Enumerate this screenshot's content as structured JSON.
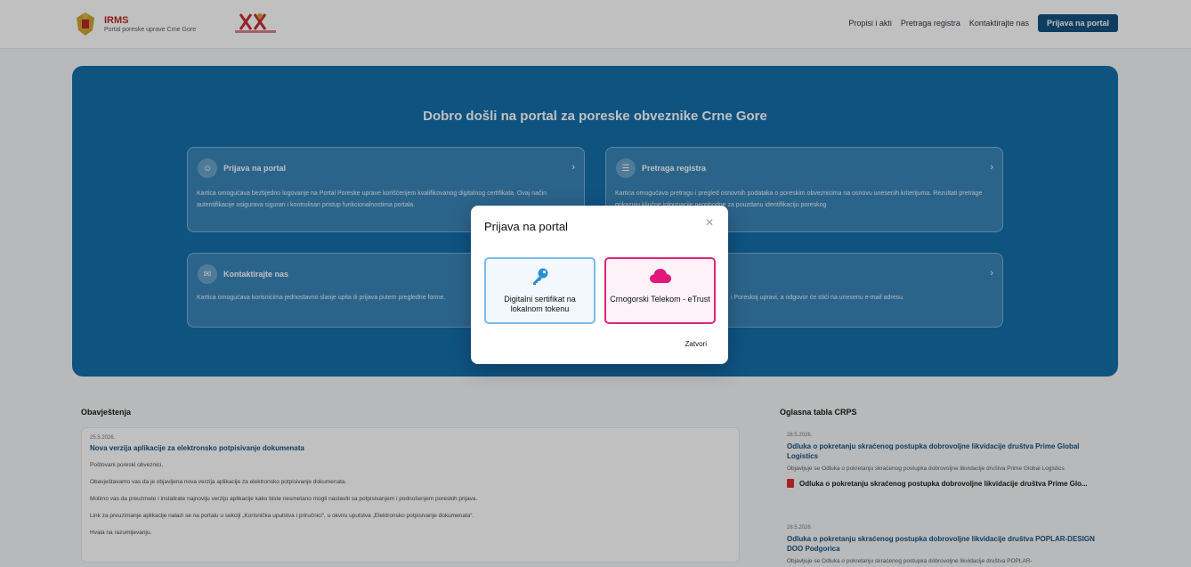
{
  "header": {
    "brand_title": "IRMS",
    "brand_subtitle": "Portal poreske uprave Crne Gore",
    "nav": [
      "Propisi i akti",
      "Pretraga registra",
      "Kontaktirajte nas"
    ],
    "cta": "Prijava na portal"
  },
  "hero": {
    "title": "Dobro došli na portal za poreske obveznike Crne Gore",
    "cards": [
      {
        "title": "Prijava na portal",
        "icon": "user-icon",
        "desc": "Kartica omogućava bezbjedno logovanje na Portal Poreske uprave korišćenjem kvalifikovanog digitalnog certifikata. Ovaj način autentifikacije osigurava siguran i kontrolisan pristup funkcionalnostima portala."
      },
      {
        "title": "Pretraga registra",
        "icon": "register-icon",
        "desc": "Kartica omogućava pretragu i pregled osnovnih podataka o poreskim obveznicima na osnovu unesenih kriterijuma. Rezultati pretrage prikazuju ključne informacije neophodne za pouzdanu identifikaciju poreskog"
      },
      {
        "title": "Kontaktirajte nas",
        "icon": "contact-icon",
        "desc": "Kartica omogućava korisnicima jednostavno slanje upita ili prijava putem pregledne forme."
      },
      {
        "title": "",
        "icon": "",
        "desc": "i Poreskoj upravi, a odgovor će stići na unesenu e-mail adresu."
      }
    ]
  },
  "modal": {
    "title": "Prijava na portal",
    "options": [
      {
        "label": "Digitalni sertifikat na lokalnom tokenu",
        "icon": "key-icon",
        "color": "#2b8fd6"
      },
      {
        "label": "Crnogorski Telekom - eTrust",
        "icon": "cloud-icon",
        "color": "#e0187a"
      }
    ],
    "close_label": "Zatvori"
  },
  "notices": {
    "title": "Obavještenja",
    "date": "25.5.2026.",
    "headline": "Nova verzija aplikacije za elektronsko potpisivanje dokumenata",
    "paragraphs": [
      "Poštovani poreski obveznici,",
      "Obavještavamo vas da je objavljena nova verzija aplikacije za elektronsko potpisivanje dokumenata.",
      "Molimo vas da preuzmete i instalirate najnoviju verziju aplikacije kako biste nesmetano mogli nastaviti sa potpisivanjem i podnošenjem poreskih prijava.",
      "Link za preuzimanje aplikacije nalazi se na portalu u sekciji „Korisnička uputstva i priručnici“, u okviru uputstva „Elektronsko potpisivanje dokumenata“.",
      "Hvala na razumijevanju."
    ]
  },
  "board": {
    "title": "Oglasna tabla CRPS",
    "items": [
      {
        "date": "28.5.2026.",
        "headline": "Odluka o pokretanju skraćenog postupka dobrovoljne likvidacije društva Prime Global Logistics",
        "desc": "Objavljuje se Odluka o pokretanju skraćenog postupka dobrovoljne likvidacije društva Prime Global Logistics",
        "file": "Odluka o pokretanju skraćenog postupka dobrovoljne likvidacije društva Prime Glo..."
      },
      {
        "date": "28.5.2026.",
        "headline": "Odluka o pokretanju skraćenog postupka dobrovoljne likvidacije društva POPLAR-DESIGN DOO Podgorica",
        "desc": "Objavljuje se Odluka o pokretanju skraćenog postupka dobrovoljne likvidacije društva POPLAR-"
      }
    ]
  }
}
